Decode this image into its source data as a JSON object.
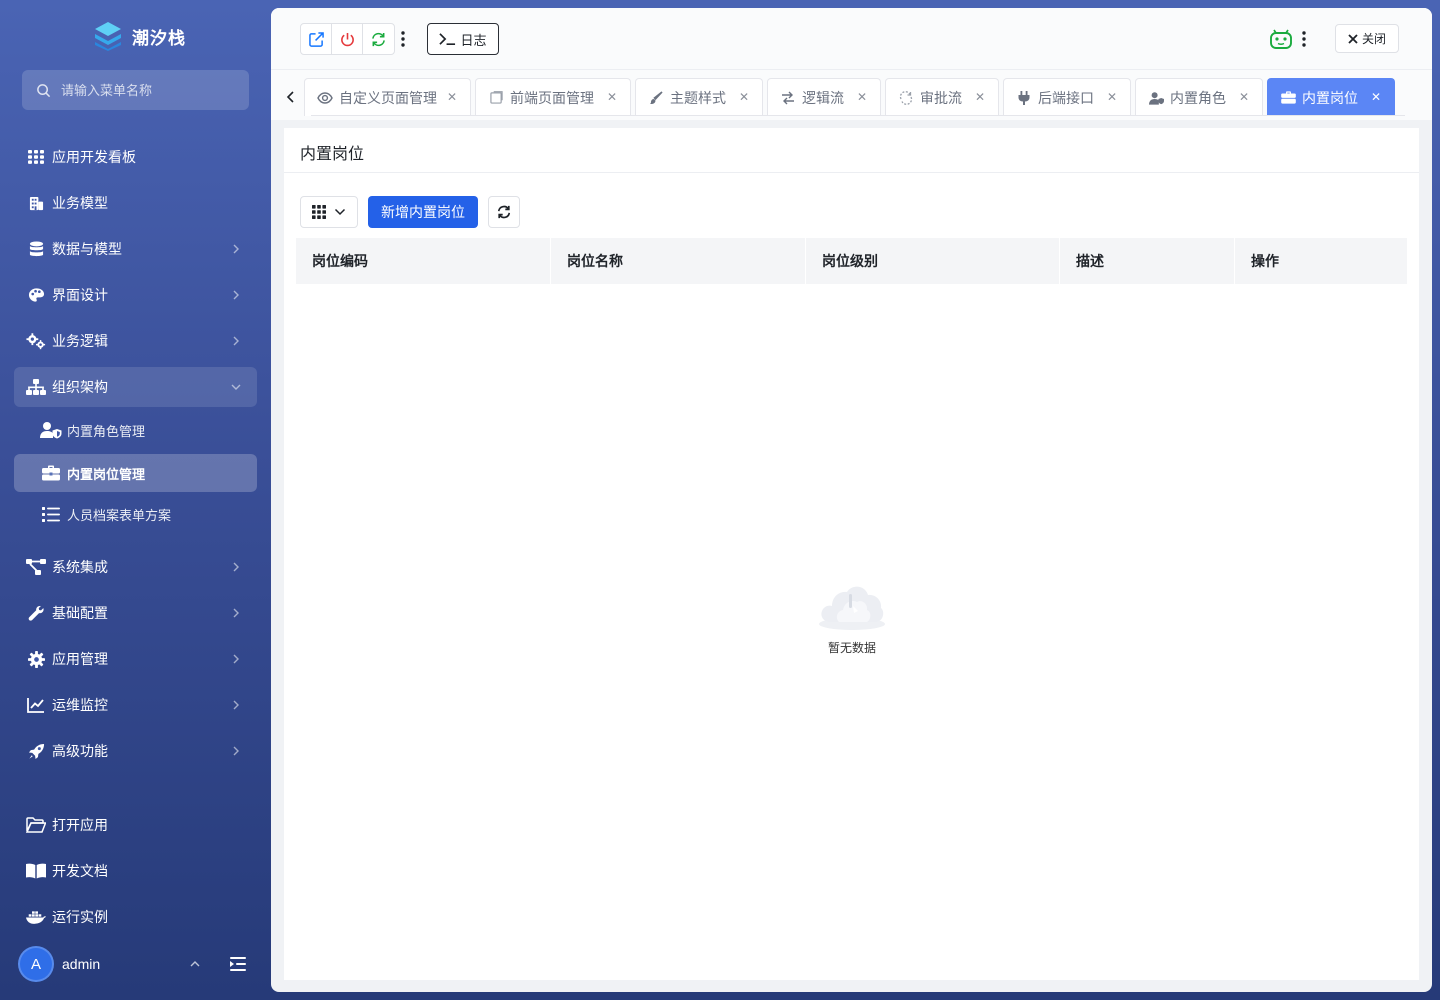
{
  "app": {
    "name": "潮汐栈"
  },
  "search": {
    "placeholder": "请输入菜单名称"
  },
  "sidebar": {
    "items": [
      {
        "label": "应用开发看板"
      },
      {
        "label": "业务模型"
      },
      {
        "label": "数据与模型"
      },
      {
        "label": "界面设计"
      },
      {
        "label": "业务逻辑"
      },
      {
        "label": "组织架构"
      },
      {
        "label": "系统集成"
      },
      {
        "label": "基础配置"
      },
      {
        "label": "应用管理"
      },
      {
        "label": "运维监控"
      },
      {
        "label": "高级功能"
      },
      {
        "label": "打开应用"
      },
      {
        "label": "开发文档"
      },
      {
        "label": "运行实例"
      }
    ],
    "sub_items": [
      {
        "label": "内置角色管理"
      },
      {
        "label": "内置岗位管理"
      },
      {
        "label": "人员档案表单方案"
      }
    ]
  },
  "user": {
    "avatar": "A",
    "name": "admin"
  },
  "topbar": {
    "log_label": "日志",
    "close_label": "关闭"
  },
  "tabs": [
    {
      "label": "自定义页面管理",
      "icon": "eye-icon"
    },
    {
      "label": "前端页面管理",
      "icon": "page-icon"
    },
    {
      "label": "主题样式",
      "icon": "brush-icon"
    },
    {
      "label": "逻辑流",
      "icon": "flow-icon"
    },
    {
      "label": "审批流",
      "icon": "approval-icon"
    },
    {
      "label": "后端接口",
      "icon": "plug-icon"
    },
    {
      "label": "内置角色",
      "icon": "user-icon"
    },
    {
      "label": "内置岗位",
      "icon": "briefcase-icon",
      "active": true
    }
  ],
  "page": {
    "title": "内置岗位",
    "add_label": "新增内置岗位",
    "columns": [
      "岗位编码",
      "岗位名称",
      "岗位级别",
      "描述",
      "操作"
    ],
    "empty_text": "暂无数据"
  },
  "colors": {
    "accent": "#2461e8",
    "active_tab": "#5b86f5",
    "sidebar_top": "#4a64b4",
    "sidebar_bottom": "#263a78"
  }
}
